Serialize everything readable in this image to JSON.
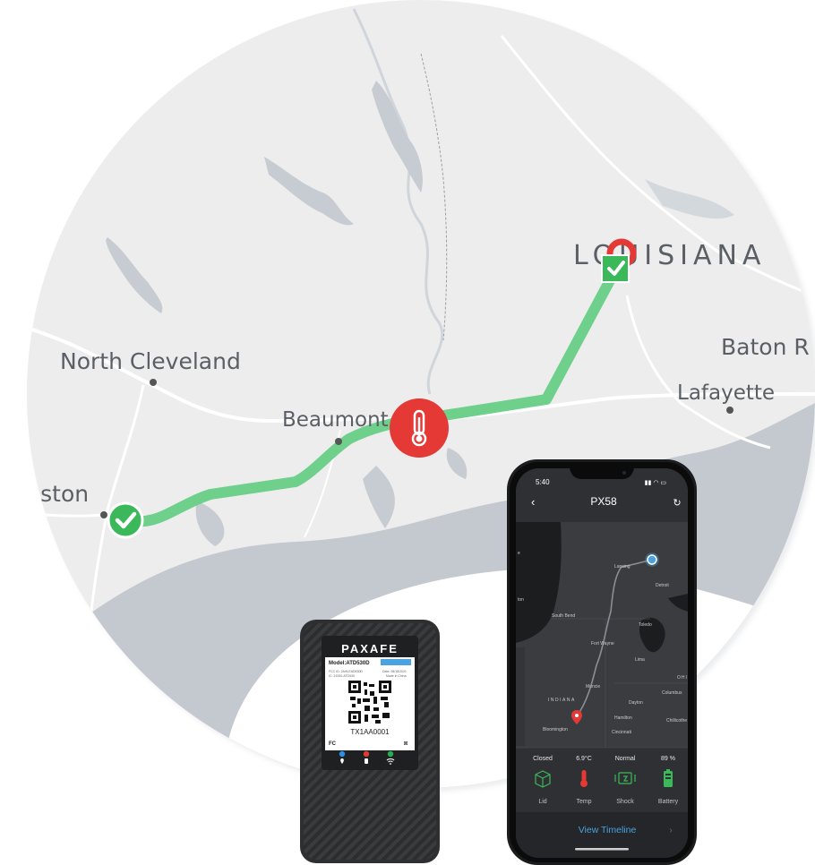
{
  "map": {
    "places": {
      "louisiana": "LOUISIANA",
      "baton": "Baton R",
      "lafayette": "Lafayette",
      "north_cleveland": "North Cleveland",
      "beaumont": "Beaumont",
      "houston": "ouston"
    },
    "route_color": "#6fd08c",
    "alert_color": "#e53935",
    "ok_color": "#3bb85a",
    "markers": [
      "check-icon",
      "thermometer-icon",
      "location-pin-icon"
    ]
  },
  "device": {
    "brand": "PAXAFE",
    "model": "Model:ATD530D",
    "fcc_line": "FCC ID: 2AHLEAD530D",
    "ic_line": "IC: 21000-ATD530",
    "date_line": "Date: 08/18/2021",
    "made_line": "Made in China",
    "serial": "TX1AA0001",
    "fc_mark": "FC",
    "led_colors": [
      "#2b8fe8",
      "#e53935",
      "#22b14c"
    ]
  },
  "phone": {
    "time": "5:40",
    "title": "PX58",
    "map_labels": {
      "lansing": "Lansing",
      "detroit": "Detroit",
      "south_bend": "South Bend",
      "toledo": "Toledo",
      "fort_wayne": "Fort Wayne",
      "lima": "Lima",
      "ohio": "OHI",
      "muncie": "Muncie",
      "columbus": "Columbus",
      "indiana": "INDIANA",
      "dayton": "Dayton",
      "hamilton": "Hamilton",
      "chillicothe": "Chillicothe",
      "bloomington": "Bloomington",
      "cincinnati": "Cincinnati",
      "edge_left_1": "e",
      "edge_left_2": "ton"
    },
    "stats": [
      {
        "value": "Closed",
        "label": "Lid",
        "icon": "box-icon",
        "color": "#3bb85a"
      },
      {
        "value": "6.9°C",
        "label": "Temp",
        "icon": "thermometer-icon",
        "color": "#e53935"
      },
      {
        "value": "Normal",
        "label": "Shock",
        "icon": "shock-icon",
        "color": "#3bb85a"
      },
      {
        "value": "89 %",
        "label": "Battery",
        "icon": "battery-icon",
        "color": "#3bb85a"
      }
    ],
    "timeline_button": "View Timeline",
    "accent": "#4aa3df"
  }
}
